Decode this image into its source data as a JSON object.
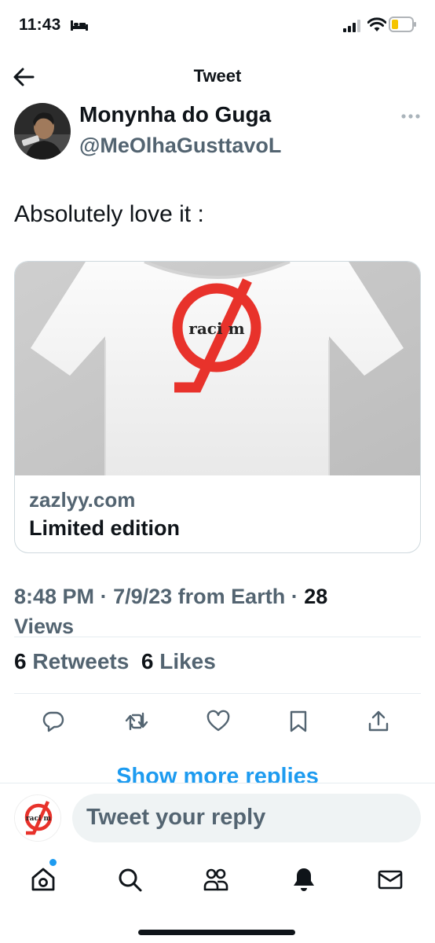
{
  "status_bar": {
    "time": "11:43",
    "icons": [
      "sleep-focus-icon",
      "cellular-signal-icon",
      "wifi-icon",
      "battery-icon"
    ]
  },
  "header": {
    "title": "Tweet",
    "back_icon": "arrow-left-icon"
  },
  "tweet": {
    "author": {
      "display_name": "Monynha do Guga",
      "handle": "@MeOlhaGusttavoL",
      "avatar_icon": "user-avatar"
    },
    "text": "Absolutely love it :",
    "card": {
      "image_text": "raci m",
      "domain": "zazlyy.com",
      "title": "Limited edition"
    },
    "meta": {
      "time": "8:48 PM",
      "date": "7/9/23",
      "source": "from Earth",
      "views_count": "28",
      "views_label": "Views"
    },
    "stats": {
      "retweets_count": "6",
      "retweets_label": "Retweets",
      "likes_count": "6",
      "likes_label": "Likes"
    },
    "actions": [
      "reply-icon",
      "retweet-icon",
      "like-icon",
      "bookmark-icon",
      "share-icon"
    ]
  },
  "show_more_replies": "Show more replies",
  "reply_bar": {
    "placeholder": "Tweet your reply",
    "avatar_text": "raci m"
  },
  "bottom_nav": [
    "home-icon",
    "search-icon",
    "communities-icon",
    "notifications-icon",
    "messages-icon"
  ],
  "colors": {
    "accent": "#1d9bf0",
    "secondary_text": "#536471",
    "logo_red": "#e8322b"
  }
}
